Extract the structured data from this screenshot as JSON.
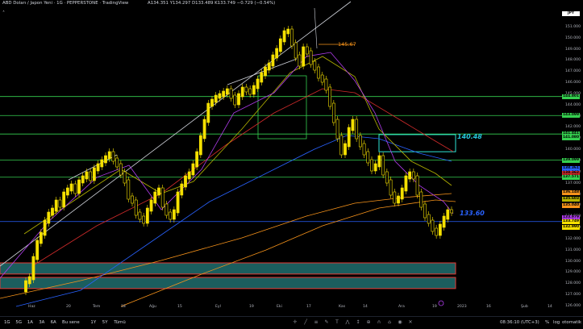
{
  "header": {
    "title": "ABD Doları / Japon Yeni · 1G · PEPPERSTONE · TradingView",
    "ohlc": "A134.351 Y134.297 D133.489 K133.749 −0.729 (−0.54%)",
    "pair_label": "JPY",
    "collapse_glyph": "˄"
  },
  "colors": {
    "up": "#f5e000",
    "down": "#f5e000",
    "ema_purple": "#b33df0",
    "ema_red": "#d12b2b",
    "ema_blue": "#2962ff",
    "ema_orange": "#f7931a",
    "ema_olive": "#b5b300",
    "hline_green": "#35d04f",
    "hline_blue": "#2962ff",
    "zone_teal": "#1b5e5e",
    "zone_border": "#e53935"
  },
  "y_axis": {
    "ticks": [
      "151.000",
      "150.000",
      "149.000",
      "148.000",
      "147.000",
      "146.000",
      "145.000",
      "144.000",
      "143.000",
      "142.000",
      "141.000",
      "140.000",
      "139.000",
      "138.000",
      "137.000",
      "136.000",
      "135.000",
      "134.000",
      "133.000",
      "132.000",
      "131.000",
      "130.000",
      "129.000",
      "128.000",
      "127.000",
      "126.000"
    ],
    "badges": [
      {
        "text": "JPY",
        "price": 152.2,
        "color": "#ffffff"
      },
      {
        "text": "144.801",
        "price": 144.801,
        "color": "#35d04f"
      },
      {
        "text": "143.099",
        "price": 143.099,
        "color": "#35d04f"
      },
      {
        "text": "141.441",
        "price": 141.441,
        "color": "#35d04f"
      },
      {
        "text": "141.080",
        "price": 141.08,
        "color": "#35d04f"
      },
      {
        "text": "139.099",
        "price": 139.099,
        "color": "#35d04f"
      },
      {
        "text": "138.361",
        "price": 138.361,
        "color": "#2962ff"
      },
      {
        "text": "138.362",
        "price": 137.95,
        "color": "#d12b2b"
      },
      {
        "text": "137.571",
        "price": 137.571,
        "color": "#35d04f"
      },
      {
        "text": "136.148",
        "price": 136.148,
        "color": "#f7931a"
      },
      {
        "text": "135.603",
        "price": 135.603,
        "color": "#b5b300"
      },
      {
        "text": "135.040",
        "price": 135.04,
        "color": "#f7931a"
      },
      {
        "text": "133.979",
        "price": 133.979,
        "color": "#b33df0"
      },
      {
        "text": "133.749",
        "price": 133.6,
        "color": "#f5e000"
      },
      {
        "text": "132.990",
        "price": 133.1,
        "color": "#f5e000"
      }
    ]
  },
  "x_axis": {
    "ticks": [
      {
        "label": "Haz",
        "price_x": 35
      },
      {
        "label": "20",
        "price_x": 82
      },
      {
        "label": "Tem",
        "price_x": 115
      },
      {
        "label": "18",
        "price_x": 150
      },
      {
        "label": "Ağu",
        "price_x": 185
      },
      {
        "label": "15",
        "price_x": 220
      },
      {
        "label": "Eyl",
        "price_x": 267
      },
      {
        "label": "19",
        "price_x": 309
      },
      {
        "label": "Eki",
        "price_x": 343
      },
      {
        "label": "17",
        "price_x": 380
      },
      {
        "label": "Kas",
        "price_x": 420
      },
      {
        "label": "14",
        "price_x": 450
      },
      {
        "label": "Ara",
        "price_x": 494
      },
      {
        "label": "19",
        "price_x": 536
      },
      {
        "label": "2023",
        "price_x": 567
      },
      {
        "label": "16",
        "price_x": 603
      },
      {
        "label": "Şub",
        "price_x": 646
      },
      {
        "label": "14",
        "price_x": 679
      }
    ]
  },
  "annotations": {
    "price_14567": "145.67",
    "price_14048": "140.48",
    "price_13360": "133.60"
  },
  "bottom": {
    "timeframes": [
      "1G",
      "5G",
      "1A",
      "3A",
      "6A",
      "Bu sene",
      "1Y",
      "5Y",
      "Tümü"
    ],
    "time": "08:36:10 (UTC+3)",
    "percent": "%",
    "log": "log",
    "auto": "otomatik"
  },
  "chart_data": {
    "type": "candlestick",
    "title": "ABD Doları / Japon Yeni · 1G · PEPPERSTONE",
    "ylim": [
      126,
      152
    ],
    "horizontal_levels": [
      144.801,
      143.099,
      141.441,
      139.099,
      137.571,
      133.6
    ],
    "zones": [
      {
        "from": 128.9,
        "to": 129.9
      },
      {
        "from": 127.6,
        "to": 128.6
      }
    ],
    "box": {
      "from": 140.0,
      "to": 141.1,
      "label": "140.48"
    }
  }
}
